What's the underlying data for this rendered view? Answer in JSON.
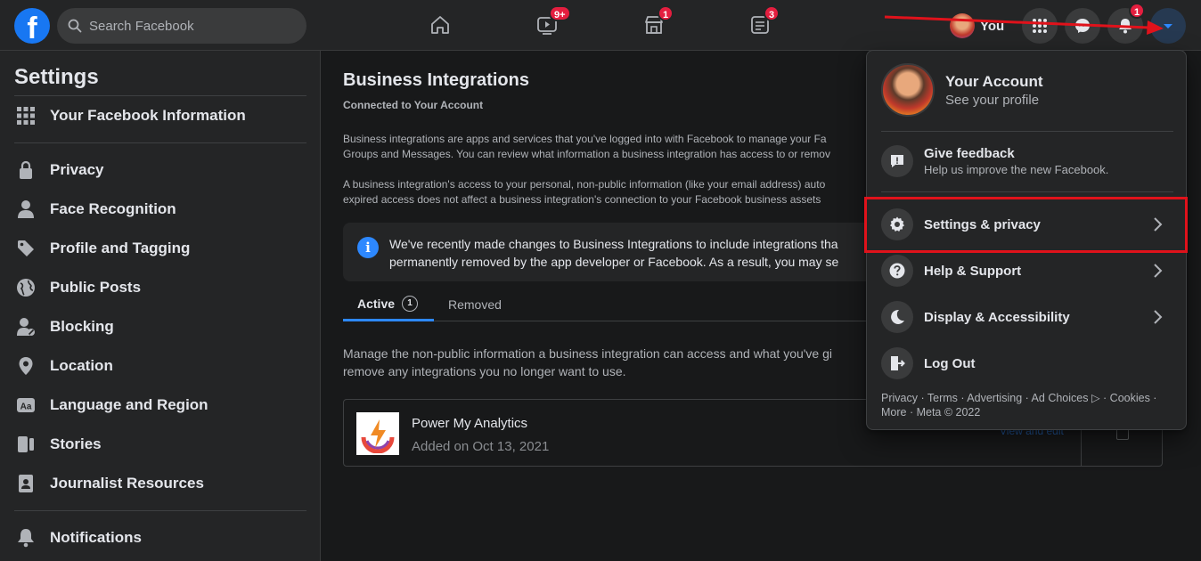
{
  "topbar": {
    "logo": "f",
    "search_placeholder": "Search Facebook",
    "badges": {
      "watch": "9+",
      "marketplace": "1",
      "news": "3",
      "notifications": "1"
    },
    "profile_label": "You"
  },
  "sidebar": {
    "title": "Settings",
    "top_item": "Your Facebook Information",
    "items": [
      {
        "label": "Privacy",
        "icon": "lock-icon"
      },
      {
        "label": "Face Recognition",
        "icon": "face-icon"
      },
      {
        "label": "Profile and Tagging",
        "icon": "tag-icon"
      },
      {
        "label": "Public Posts",
        "icon": "globe-icon"
      },
      {
        "label": "Blocking",
        "icon": "block-icon"
      },
      {
        "label": "Location",
        "icon": "pin-icon"
      },
      {
        "label": "Language and Region",
        "icon": "language-icon"
      },
      {
        "label": "Stories",
        "icon": "stories-icon"
      },
      {
        "label": "Journalist Resources",
        "icon": "journalist-icon"
      }
    ],
    "bottom_item": "Notifications"
  },
  "main": {
    "title": "Business Integrations",
    "subtitle": "Connected to Your Account",
    "para1_line1": "Business integrations are apps and services that you've logged into with Facebook to manage your Fa",
    "para1_line2": "Groups and Messages. You can review what information a business integration has access to or remov",
    "para2_line1": "A business integration's access to your personal, non-public information (like your email address) auto",
    "para2_line2": "expired access does not affect a business integration's connection to your Facebook business assets",
    "notice_line1": "We've recently made changes to Business Integrations to include integrations tha",
    "notice_line2": "permanently removed by the app developer or Facebook. As a result, you may se",
    "tabs": {
      "active": "Active",
      "active_count": "1",
      "removed": "Removed"
    },
    "manage_line1": "Manage the non-public information a business integration can access and what you've gi",
    "manage_line2": "remove any integrations you no longer want to use.",
    "integration": {
      "name": "Power My Analytics",
      "date": "Added on Oct 13, 2021",
      "edit_link": "View and edit"
    }
  },
  "menu": {
    "account_name": "Your Account",
    "account_sub": "See your profile",
    "feedback_label": "Give feedback",
    "feedback_sub": "Help us improve the new Facebook.",
    "items": [
      {
        "label": "Settings & privacy",
        "icon": "gear-icon"
      },
      {
        "label": "Help & Support",
        "icon": "help-icon"
      },
      {
        "label": "Display & Accessibility",
        "icon": "moon-icon"
      },
      {
        "label": "Log Out",
        "icon": "logout-icon"
      }
    ],
    "footer_line1": "Privacy · Terms · Advertising · Ad Choices ▷ · Cookies ·",
    "footer_line2": "More · Meta © 2022"
  },
  "colors": {
    "accent": "#2d88ff",
    "badge": "#e41e3f",
    "annotation": "#e0121b"
  }
}
